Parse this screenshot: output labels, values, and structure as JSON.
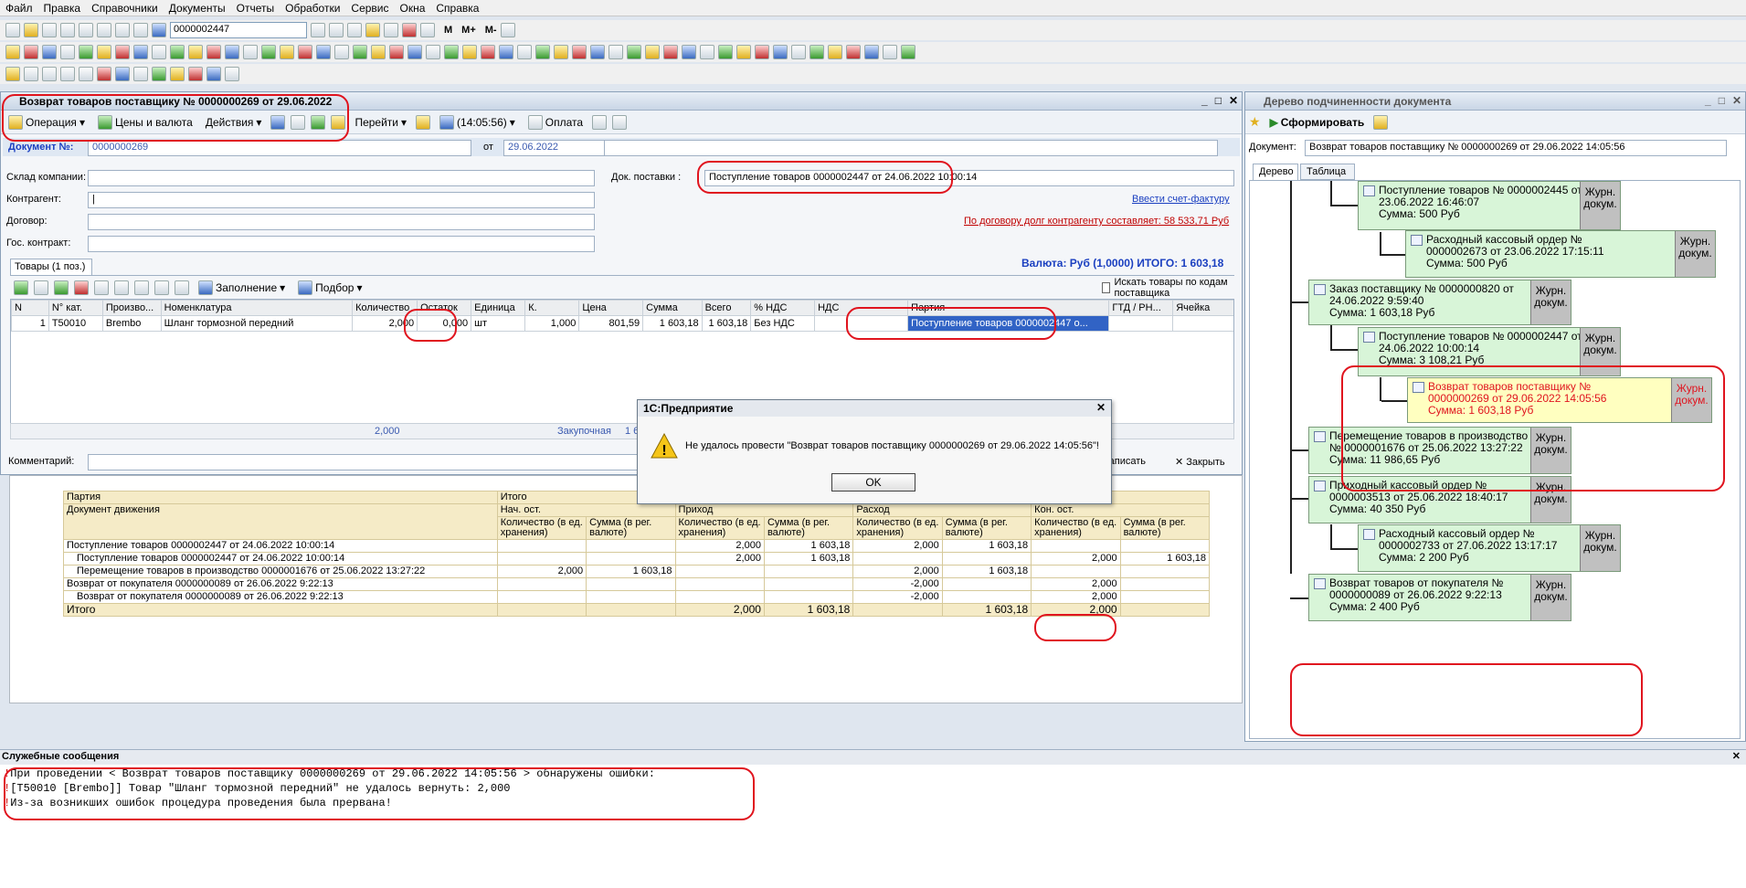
{
  "menu": [
    "Файл",
    "Правка",
    "Справочники",
    "Документы",
    "Отчеты",
    "Обработки",
    "Сервис",
    "Окна",
    "Справка"
  ],
  "toolbar": {
    "search_value": "0000002447",
    "m_labels": [
      "M",
      "M+",
      "M-"
    ]
  },
  "doc": {
    "title": "Возврат товаров поставщику № 0000000269 от 29.06.2022",
    "buttons": {
      "operation": "Операция",
      "prices": "Цены и валюта",
      "actions": "Действия",
      "goto": "Перейти",
      "time": "(14:05:56)",
      "pay": "Оплата"
    },
    "labels": {
      "doc_no": "Документ №:",
      "from": "от",
      "warehouse": "Склад компании:",
      "contractor": "Контрагент:",
      "contract": "Договор:",
      "gos": "Гос. контракт:",
      "supply_doc": "Док. поставки :",
      "comment": "Комментарий:"
    },
    "values": {
      "doc_no": "0000000269",
      "date": "29.06.2022",
      "supply_doc": "Поступление товаров 0000002447 от 24.06.2022 10:00:14",
      "contractor": "|"
    },
    "links": {
      "invoice": "Ввести счет-фактуру",
      "debt": "По договору долг контрагенту составляет: 58 533,71 Руб"
    },
    "currency": "Валюта: Руб (1,0000) ИТОГО: 1 603,18",
    "tab": "Товары (1 поз.)",
    "fill": "Заполнение",
    "pick": "Подбор",
    "search_codes": "Искать товары по кодам поставщика",
    "columns": [
      "N",
      "N° кат.",
      "Произво...",
      "Номенклатура",
      "Количество",
      "Остаток",
      "Единица",
      "К.",
      "Цена",
      "Сумма",
      "Всего",
      "% НДС",
      "НДС",
      "Партия",
      "ГТД / РН...",
      "Ячейка"
    ],
    "row": [
      "1",
      "T50010",
      "Brembo",
      "Шланг тормозной передний",
      "2,000",
      "0,000",
      "шт",
      "1,000",
      "801,59",
      "1 603,18",
      "1 603,18",
      "Без НДС",
      "",
      "Поступление товаров 0000002447 о...",
      "",
      ""
    ],
    "footer_qty": "2,000",
    "footer_price": "Закупочная",
    "footer_price_rest": "1 6",
    "write": "Записать",
    "close": "Закрыть"
  },
  "dialog": {
    "title": "1С:Предприятие",
    "message": "Не удалось провести \"Возврат товаров поставщику 0000000269 от 29.06.2022 14:05:56\"!",
    "ok": "OK"
  },
  "movements": {
    "h_party": "Партия",
    "h_doc": "Документ движения",
    "h_total": "Итого",
    "groups": [
      "Нач. ост.",
      "Приход",
      "Расход",
      "Кон. ост."
    ],
    "sub": [
      "Количество (в ед. хранения)",
      "Сумма (в рег. валюте)"
    ],
    "rows": [
      {
        "name": "Поступление товаров 0000002447 от 24.06.2022 10:00:14",
        "lvl": 0,
        "v": [
          "",
          "",
          "2,000",
          "1 603,18",
          "2,000",
          "1 603,18",
          "",
          ""
        ]
      },
      {
        "name": "Поступление товаров 0000002447 от 24.06.2022 10:00:14",
        "lvl": 1,
        "v": [
          "",
          "",
          "2,000",
          "1 603,18",
          "",
          "",
          "2,000",
          "1 603,18"
        ]
      },
      {
        "name": "Перемещение товаров в производство 0000001676 от 25.06.2022 13:27:22",
        "lvl": 1,
        "v": [
          "2,000",
          "1 603,18",
          "",
          "",
          "2,000",
          "1 603,18",
          "",
          ""
        ]
      },
      {
        "name": "Возврат от покупателя 0000000089 от 26.06.2022 9:22:13",
        "lvl": 0,
        "v": [
          "",
          "",
          "",
          "",
          "-2,000",
          "",
          "2,000",
          ""
        ]
      },
      {
        "name": "Возврат от покупателя 0000000089 от 26.06.2022 9:22:13",
        "lvl": 1,
        "v": [
          "",
          "",
          "",
          "",
          "-2,000",
          "",
          "2,000",
          ""
        ]
      }
    ],
    "total": {
      "name": "Итого",
      "v": [
        "",
        "",
        "2,000",
        "1 603,18",
        "",
        "1 603,18",
        "2,000",
        ""
      ]
    }
  },
  "tree": {
    "title": "Дерево подчиненности документа",
    "form": "Сформировать",
    "doc_label": "Документ:",
    "doc_value": "Возврат товаров поставщику № 0000000269 от 29.06.2022 14:05:56",
    "tabs": [
      "Дерево",
      "Таблица"
    ],
    "jr": "Журн. докум.",
    "nodes": [
      {
        "l1": "Поступление товаров № 0000002445 от",
        "l2": "23.06.2022 16:46:07",
        "l3": "Сумма: 500 Руб"
      },
      {
        "l1": "Расходный кассовый ордер №",
        "l2": "0000002673 от 23.06.2022 17:15:11",
        "l3": "Сумма: 500 Руб"
      },
      {
        "l1": "Заказ поставщику № 0000000820 от",
        "l2": "24.06.2022 9:59:40",
        "l3": "Сумма: 1 603,18 Руб"
      },
      {
        "l1": "Поступление товаров № 0000002447 от",
        "l2": "24.06.2022 10:00:14",
        "l3": "Сумма: 3 108,21 Руб"
      },
      {
        "l1": "Возврат товаров поставщику №",
        "l2": "0000000269 от 29.06.2022 14:05:56",
        "l3": "Сумма: 1 603,18 Руб"
      },
      {
        "l1": "Перемещение товаров в производство",
        "l2": "№ 0000001676 от 25.06.2022 13:27:22",
        "l3": "Сумма: 11 986,65 Руб"
      },
      {
        "l1": "Приходный кассовый ордер №",
        "l2": "0000003513 от 25.06.2022 18:40:17",
        "l3": "Сумма: 40 350 Руб"
      },
      {
        "l1": "Расходный кассовый ордер №",
        "l2": "0000002733 от 27.06.2022 13:17:17",
        "l3": "Сумма: 2 200 Руб"
      },
      {
        "l1": "Возврат товаров от покупателя №",
        "l2": "0000000089 от 26.06.2022 9:22:13",
        "l3": "Сумма: 2 400 Руб"
      }
    ]
  },
  "messages": {
    "title": "Служебные сообщения",
    "lines": [
      "При проведении < Возврат товаров поставщику 0000000269 от 29.06.2022 14:05:56 > обнаружены ошибки:",
      "[T50010 [Brembo]] Товар \"Шланг тормозной передний\" не удалось вернуть: 2,000",
      "Из-за возникших ошибок процедура проведения  была прервана!"
    ]
  },
  "colors": {
    "red_mark": "#e0141e",
    "node_green": "#d8f5d8",
    "node_yellow": "#ffffc0",
    "link": "#1a3fc0"
  }
}
